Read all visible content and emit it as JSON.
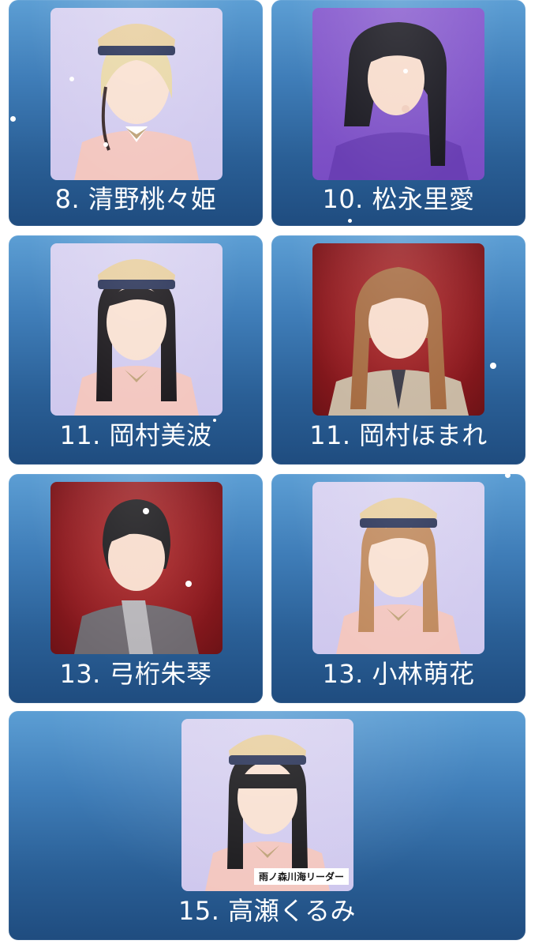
{
  "members": [
    {
      "caption": "8. 清野桃々姫",
      "photo_alt": "member-photo",
      "background": "lavender"
    },
    {
      "caption": "10. 松永里愛",
      "photo_alt": "member-photo",
      "background": "purple"
    },
    {
      "caption": "11. 岡村美波",
      "photo_alt": "member-photo",
      "background": "lavender"
    },
    {
      "caption": "11. 岡村ほまれ",
      "photo_alt": "member-photo",
      "background": "red"
    },
    {
      "caption": "13. 弓桁朱琴",
      "photo_alt": "member-photo",
      "background": "red"
    },
    {
      "caption": "13. 小林萌花",
      "photo_alt": "member-photo",
      "background": "lavender"
    },
    {
      "caption": "15. 高瀬くるみ",
      "photo_alt": "member-photo",
      "background": "lavender",
      "badge": "雨ノ森川海リーダー"
    }
  ],
  "colors": {
    "card_gradient_top": "#5c9ed4",
    "card_gradient_bottom": "#1f4c7f",
    "caption_text": "#ffffff",
    "page_background": "#ffffff"
  }
}
